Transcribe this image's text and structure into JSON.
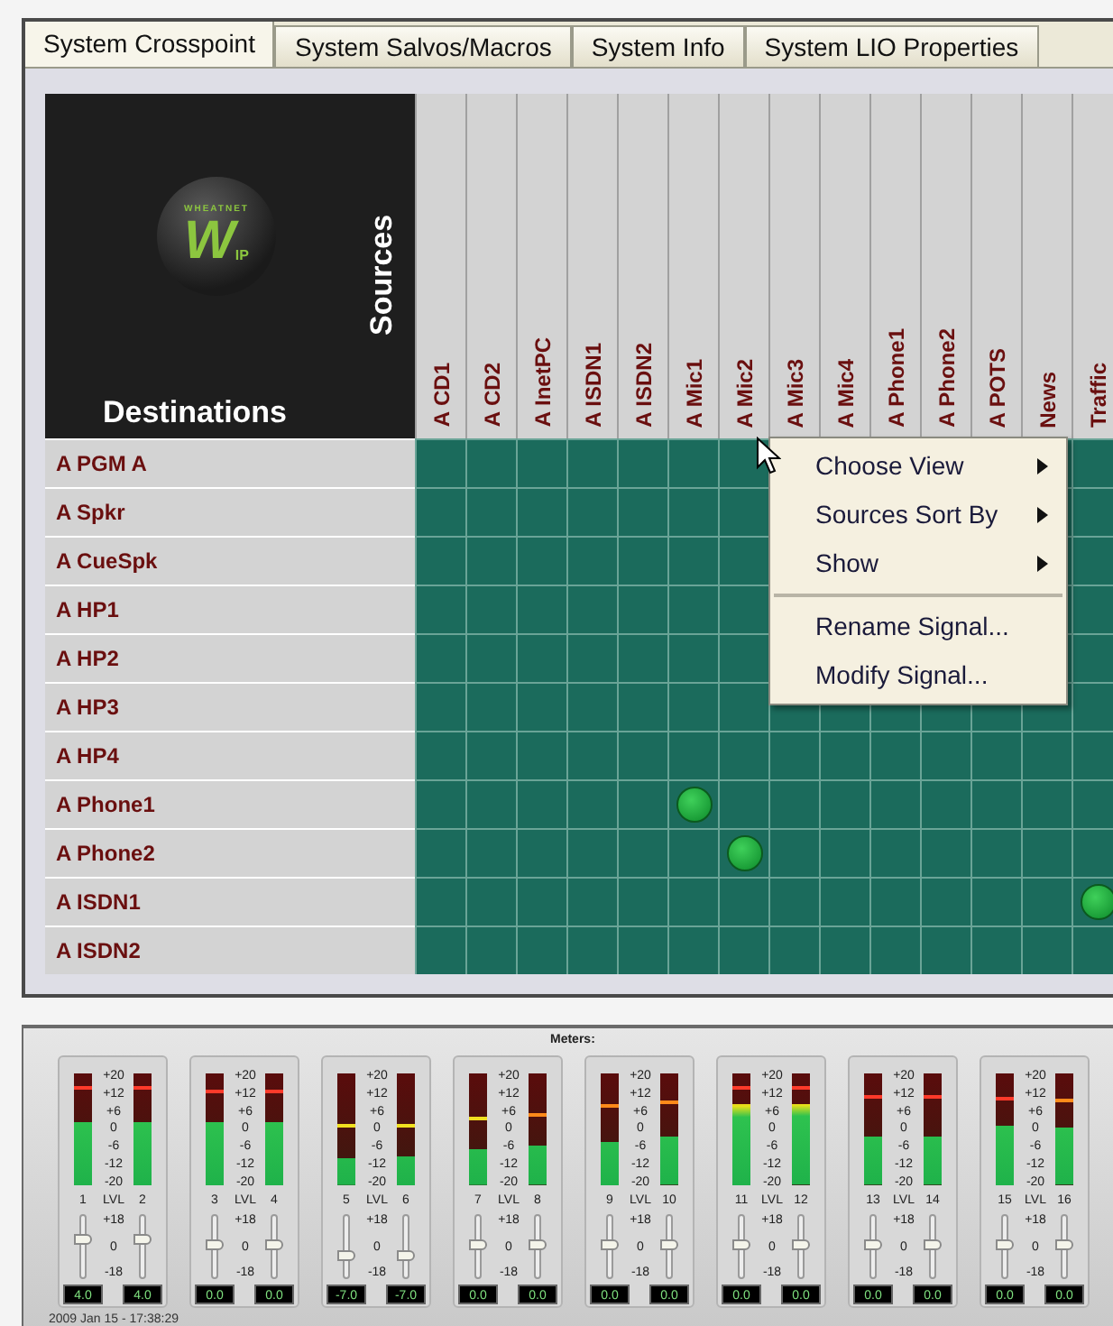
{
  "tabs": [
    {
      "label": "System Crosspoint",
      "selected": true
    },
    {
      "label": "System Salvos/Macros",
      "selected": false
    },
    {
      "label": "System Info",
      "selected": false
    },
    {
      "label": "System LIO Properties",
      "selected": false
    }
  ],
  "logo": {
    "wordmark": "WHEATNET",
    "letter": "W",
    "suffix": "IP"
  },
  "sources_label": "Sources",
  "destinations_label": "Destinations",
  "sources": [
    "A CD1",
    "A CD2",
    "A InetPC",
    "A ISDN1",
    "A ISDN2",
    "A Mic1",
    "A Mic2",
    "A Mic3",
    "A Mic4",
    "A Phone1",
    "A Phone2",
    "A POTS",
    "News",
    "Traffic"
  ],
  "destinations": [
    {
      "name": "A PGM A",
      "crosspoints": [
        {
          "kind": "cell",
          "connected": false
        },
        {
          "kind": "cell",
          "connected": false
        },
        {
          "kind": "cell",
          "connected": false
        },
        {
          "kind": "cell",
          "connected": false
        },
        {
          "kind": "cell",
          "connected": false
        },
        {
          "kind": "cell",
          "connected": false
        },
        {
          "kind": "cell",
          "connected": false
        },
        {
          "kind": "covered"
        },
        {
          "kind": "covered"
        },
        {
          "kind": "covered"
        },
        {
          "kind": "covered"
        },
        {
          "kind": "covered"
        },
        {
          "kind": "covered"
        },
        {
          "kind": "cell",
          "connected": false
        }
      ]
    },
    {
      "name": "A Spkr",
      "crosspoints": [
        {
          "kind": "cell",
          "connected": false
        },
        {
          "kind": "cell",
          "connected": false
        },
        {
          "kind": "cell",
          "connected": false
        },
        {
          "kind": "cell",
          "connected": false
        },
        {
          "kind": "cell",
          "connected": false
        },
        {
          "kind": "cell",
          "connected": false
        },
        {
          "kind": "cell",
          "connected": false
        },
        {
          "kind": "covered"
        },
        {
          "kind": "covered"
        },
        {
          "kind": "covered"
        },
        {
          "kind": "covered"
        },
        {
          "kind": "covered"
        },
        {
          "kind": "covered"
        },
        {
          "kind": "cell",
          "connected": false
        }
      ]
    },
    {
      "name": "A CueSpk",
      "crosspoints": [
        {
          "kind": "cell",
          "connected": false
        },
        {
          "kind": "cell",
          "connected": false
        },
        {
          "kind": "cell",
          "connected": false
        },
        {
          "kind": "cell",
          "connected": false
        },
        {
          "kind": "cell",
          "connected": false
        },
        {
          "kind": "cell",
          "connected": false
        },
        {
          "kind": "cell",
          "connected": false
        },
        {
          "kind": "covered"
        },
        {
          "kind": "covered"
        },
        {
          "kind": "covered"
        },
        {
          "kind": "covered"
        },
        {
          "kind": "covered"
        },
        {
          "kind": "covered"
        },
        {
          "kind": "cell",
          "connected": false
        }
      ]
    },
    {
      "name": "A HP1",
      "crosspoints": [
        {
          "kind": "cell",
          "connected": false
        },
        {
          "kind": "cell",
          "connected": false
        },
        {
          "kind": "cell",
          "connected": false
        },
        {
          "kind": "cell",
          "connected": false
        },
        {
          "kind": "cell",
          "connected": false
        },
        {
          "kind": "cell",
          "connected": false
        },
        {
          "kind": "cell",
          "connected": false
        },
        {
          "kind": "covered"
        },
        {
          "kind": "covered"
        },
        {
          "kind": "covered"
        },
        {
          "kind": "covered"
        },
        {
          "kind": "covered"
        },
        {
          "kind": "covered"
        },
        {
          "kind": "cell",
          "connected": false
        }
      ]
    },
    {
      "name": "A HP2",
      "crosspoints": [
        {
          "kind": "cell",
          "connected": false
        },
        {
          "kind": "cell",
          "connected": false
        },
        {
          "kind": "cell",
          "connected": false
        },
        {
          "kind": "cell",
          "connected": false
        },
        {
          "kind": "cell",
          "connected": false
        },
        {
          "kind": "cell",
          "connected": false
        },
        {
          "kind": "cell",
          "connected": false
        },
        {
          "kind": "covered"
        },
        {
          "kind": "covered"
        },
        {
          "kind": "covered"
        },
        {
          "kind": "covered"
        },
        {
          "kind": "covered"
        },
        {
          "kind": "covered"
        },
        {
          "kind": "cell",
          "connected": false
        }
      ]
    },
    {
      "name": "A HP3",
      "crosspoints": [
        {
          "kind": "cell",
          "connected": false
        },
        {
          "kind": "cell",
          "connected": false
        },
        {
          "kind": "cell",
          "connected": false
        },
        {
          "kind": "cell",
          "connected": false
        },
        {
          "kind": "cell",
          "connected": false
        },
        {
          "kind": "cell",
          "connected": false
        },
        {
          "kind": "cell",
          "connected": false
        },
        {
          "kind": "cell",
          "connected": false
        },
        {
          "kind": "cell",
          "connected": false
        },
        {
          "kind": "cell",
          "connected": false
        },
        {
          "kind": "cell",
          "connected": false
        },
        {
          "kind": "cell",
          "connected": false
        },
        {
          "kind": "cell",
          "connected": false
        },
        {
          "kind": "cell",
          "connected": false
        }
      ]
    },
    {
      "name": "A HP4",
      "crosspoints": [
        {
          "kind": "cell",
          "connected": false
        },
        {
          "kind": "cell",
          "connected": false
        },
        {
          "kind": "cell",
          "connected": false
        },
        {
          "kind": "cell",
          "connected": false
        },
        {
          "kind": "cell",
          "connected": false
        },
        {
          "kind": "cell",
          "connected": false
        },
        {
          "kind": "cell",
          "connected": false
        },
        {
          "kind": "cell",
          "connected": false
        },
        {
          "kind": "cell",
          "connected": false
        },
        {
          "kind": "cell",
          "connected": false
        },
        {
          "kind": "cell",
          "connected": false
        },
        {
          "kind": "cell",
          "connected": false
        },
        {
          "kind": "cell",
          "connected": false
        },
        {
          "kind": "cell",
          "connected": false
        }
      ]
    },
    {
      "name": "A Phone1",
      "crosspoints": [
        {
          "kind": "cell",
          "connected": false
        },
        {
          "kind": "cell",
          "connected": false
        },
        {
          "kind": "cell",
          "connected": false
        },
        {
          "kind": "cell",
          "connected": false
        },
        {
          "kind": "cell",
          "connected": false
        },
        {
          "kind": "cell",
          "connected": true
        },
        {
          "kind": "cell",
          "connected": false
        },
        {
          "kind": "cell",
          "connected": false
        },
        {
          "kind": "cell",
          "connected": false
        },
        {
          "kind": "cell",
          "connected": false
        },
        {
          "kind": "cell",
          "connected": false
        },
        {
          "kind": "cell",
          "connected": false
        },
        {
          "kind": "cell",
          "connected": false
        },
        {
          "kind": "cell",
          "connected": false
        }
      ]
    },
    {
      "name": "A Phone2",
      "crosspoints": [
        {
          "kind": "cell",
          "connected": false
        },
        {
          "kind": "cell",
          "connected": false
        },
        {
          "kind": "cell",
          "connected": false
        },
        {
          "kind": "cell",
          "connected": false
        },
        {
          "kind": "cell",
          "connected": false
        },
        {
          "kind": "cell",
          "connected": false
        },
        {
          "kind": "cell",
          "connected": true
        },
        {
          "kind": "cell",
          "connected": false
        },
        {
          "kind": "cell",
          "connected": false
        },
        {
          "kind": "cell",
          "connected": false
        },
        {
          "kind": "cell",
          "connected": false
        },
        {
          "kind": "cell",
          "connected": false
        },
        {
          "kind": "cell",
          "connected": false
        },
        {
          "kind": "cell",
          "connected": false
        }
      ]
    },
    {
      "name": "A ISDN1",
      "crosspoints": [
        {
          "kind": "cell",
          "connected": false
        },
        {
          "kind": "cell",
          "connected": false
        },
        {
          "kind": "cell",
          "connected": false
        },
        {
          "kind": "cell",
          "connected": false
        },
        {
          "kind": "cell",
          "connected": false
        },
        {
          "kind": "cell",
          "connected": false
        },
        {
          "kind": "cell",
          "connected": false
        },
        {
          "kind": "cell",
          "connected": false
        },
        {
          "kind": "cell",
          "connected": false
        },
        {
          "kind": "cell",
          "connected": false
        },
        {
          "kind": "cell",
          "connected": false
        },
        {
          "kind": "cell",
          "connected": false
        },
        {
          "kind": "cell",
          "connected": false
        },
        {
          "kind": "cell",
          "connected": true
        }
      ]
    },
    {
      "name": "A ISDN2",
      "crosspoints": [
        {
          "kind": "cell",
          "connected": false
        },
        {
          "kind": "cell",
          "connected": false
        },
        {
          "kind": "cell",
          "connected": false
        },
        {
          "kind": "cell",
          "connected": false
        },
        {
          "kind": "cell",
          "connected": false
        },
        {
          "kind": "cell",
          "connected": false
        },
        {
          "kind": "cell",
          "connected": false
        },
        {
          "kind": "cell",
          "connected": false
        },
        {
          "kind": "cell",
          "connected": false
        },
        {
          "kind": "cell",
          "connected": false
        },
        {
          "kind": "cell",
          "connected": false
        },
        {
          "kind": "cell",
          "connected": false
        },
        {
          "kind": "cell",
          "connected": false
        },
        {
          "kind": "cell",
          "connected": false
        }
      ]
    }
  ],
  "context_menu": [
    {
      "kind": "submenu",
      "label": "Choose View"
    },
    {
      "kind": "submenu",
      "label": "Sources Sort By"
    },
    {
      "kind": "submenu",
      "label": "Show"
    },
    {
      "kind": "separator"
    },
    {
      "kind": "item",
      "label": "Rename Signal..."
    },
    {
      "kind": "item",
      "label": "Modify Signal..."
    }
  ],
  "meters": {
    "title": "Meters:",
    "timestamp": "2009 Jan 15 - 17:38:29",
    "groups": [
      {
        "scale": [
          "+20",
          "+12",
          "+6",
          "0",
          "-6",
          "-12",
          "-20"
        ],
        "lvl_label": "LVL",
        "fader_scale": [
          "+18",
          "0",
          "-18"
        ],
        "channels": [
          {
            "number": "1",
            "level": 0.57,
            "peak": {
              "level": 0.86
            },
            "fader": {
              "level": 0.63
            },
            "value": "4.0"
          },
          {
            "number": "2",
            "level": 0.57,
            "peak": {
              "level": 0.86
            },
            "fader": {
              "level": 0.63
            },
            "value": "4.0"
          }
        ]
      },
      {
        "scale": [
          "+20",
          "+12",
          "+6",
          "0",
          "-6",
          "-12",
          "-20"
        ],
        "lvl_label": "LVL",
        "fader_scale": [
          "+18",
          "0",
          "-18"
        ],
        "channels": [
          {
            "number": "3",
            "level": 0.57,
            "peak": {
              "level": 0.83
            },
            "fader": {
              "level": 0.54
            },
            "value": "0.0"
          },
          {
            "number": "4",
            "level": 0.57,
            "peak": {
              "level": 0.83
            },
            "fader": {
              "level": 0.54
            },
            "value": "0.0"
          }
        ]
      },
      {
        "scale": [
          "+20",
          "+12",
          "+6",
          "0",
          "-6",
          "-12",
          "-20"
        ],
        "lvl_label": "LVL",
        "fader_scale": [
          "+18",
          "0",
          "-18"
        ],
        "channels": [
          {
            "number": "5",
            "level": 0.24,
            "peak": {
              "level": 0.51
            },
            "fader": {
              "level": 0.35
            },
            "value": "-7.0"
          },
          {
            "number": "6",
            "level": 0.26,
            "peak": {
              "level": 0.51
            },
            "fader": {
              "level": 0.35
            },
            "value": "-7.0"
          }
        ]
      },
      {
        "scale": [
          "+20",
          "+12",
          "+6",
          "0",
          "-6",
          "-12",
          "-20"
        ],
        "lvl_label": "LVL",
        "fader_scale": [
          "+18",
          "0",
          "-18"
        ],
        "channels": [
          {
            "number": "7",
            "level": 0.32,
            "peak": {
              "level": 0.58
            },
            "fader": {
              "level": 0.54
            },
            "value": "0.0"
          },
          {
            "number": "8",
            "level": 0.35,
            "peak": {
              "level": 0.62
            },
            "fader": {
              "level": 0.54
            },
            "value": "0.0"
          }
        ]
      },
      {
        "scale": [
          "+20",
          "+12",
          "+6",
          "0",
          "-6",
          "-12",
          "-20"
        ],
        "lvl_label": "LVL",
        "fader_scale": [
          "+18",
          "0",
          "-18"
        ],
        "channels": [
          {
            "number": "9",
            "level": 0.39,
            "peak": {
              "level": 0.69
            },
            "fader": {
              "level": 0.54
            },
            "value": "0.0"
          },
          {
            "number": "10",
            "level": 0.43,
            "peak": {
              "level": 0.73
            },
            "fader": {
              "level": 0.54
            },
            "value": "0.0"
          }
        ]
      },
      {
        "scale": [
          "+20",
          "+12",
          "+6",
          "0",
          "-6",
          "-12",
          "-20"
        ],
        "lvl_label": "LVL",
        "fader_scale": [
          "+18",
          "0",
          "-18"
        ],
        "channels": [
          {
            "number": "11",
            "level": 0.73,
            "peak": {
              "level": 0.85
            },
            "fader": {
              "level": 0.54
            },
            "value": "0.0"
          },
          {
            "number": "12",
            "level": 0.72,
            "peak": {
              "level": 0.85
            },
            "fader": {
              "level": 0.54
            },
            "value": "0.0"
          }
        ]
      },
      {
        "scale": [
          "+20",
          "+12",
          "+6",
          "0",
          "-6",
          "-12",
          "-20"
        ],
        "lvl_label": "LVL",
        "fader_scale": [
          "+18",
          "0",
          "-18"
        ],
        "channels": [
          {
            "number": "13",
            "level": 0.43,
            "peak": {
              "level": 0.77
            },
            "fader": {
              "level": 0.54
            },
            "value": "0.0"
          },
          {
            "number": "14",
            "level": 0.43,
            "peak": {
              "level": 0.77
            },
            "fader": {
              "level": 0.54
            },
            "value": "0.0"
          }
        ]
      },
      {
        "scale": [
          "+20",
          "+12",
          "+6",
          "0",
          "-6",
          "-12",
          "-20"
        ],
        "lvl_label": "LVL",
        "fader_scale": [
          "+18",
          "0",
          "-18"
        ],
        "channels": [
          {
            "number": "15",
            "level": 0.54,
            "peak": {
              "level": 0.76
            },
            "fader": {
              "level": 0.54
            },
            "value": "0.0"
          },
          {
            "number": "16",
            "level": 0.51,
            "peak": {
              "level": 0.74
            },
            "fader": {
              "level": 0.54
            },
            "value": "0.0"
          }
        ]
      }
    ]
  }
}
